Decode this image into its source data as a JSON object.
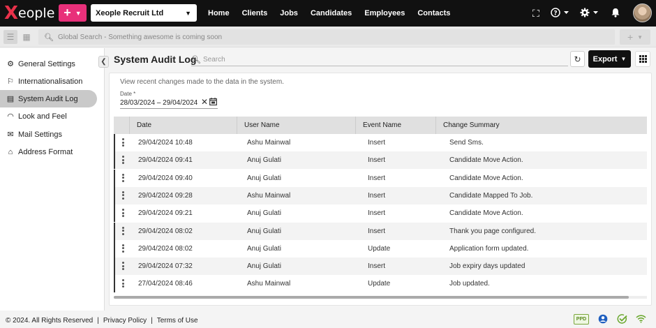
{
  "app": {
    "logo_x": "X",
    "logo_text": "eople",
    "add_label": "+",
    "company": "Xeople Recruit Ltd"
  },
  "nav": [
    "Home",
    "Clients",
    "Jobs",
    "Candidates",
    "Employees",
    "Contacts"
  ],
  "global_search": {
    "placeholder": "Global Search - Something awesome is coming soon"
  },
  "sidebar": {
    "items": [
      {
        "label": "General Settings",
        "icon": "gear-icon"
      },
      {
        "label": "Internationalisation",
        "icon": "flag-icon"
      },
      {
        "label": "System Audit Log",
        "icon": "audit-log-icon"
      },
      {
        "label": "Look and Feel",
        "icon": "palette-icon"
      },
      {
        "label": "Mail Settings",
        "icon": "mail-icon"
      },
      {
        "label": "Address Format",
        "icon": "home-icon"
      }
    ]
  },
  "page": {
    "title": "System Audit Log",
    "search_placeholder": "Search",
    "export_label": "Export",
    "description": "View recent changes made to the data in the system.",
    "date_label": "Date *",
    "date_value": "28/03/2024 – 29/04/2024"
  },
  "table": {
    "columns": [
      "Date",
      "User Name",
      "Event Name",
      "Change Summary"
    ],
    "rows": [
      {
        "date": "29/04/2024 10:48",
        "user": "Ashu Mainwal",
        "event": "Insert",
        "summary": "Send Sms."
      },
      {
        "date": "29/04/2024 09:41",
        "user": "Anuj Gulati",
        "event": "Insert",
        "summary": "Candidate Move Action."
      },
      {
        "date": "29/04/2024 09:40",
        "user": "Anuj Gulati",
        "event": "Insert",
        "summary": "Candidate Move Action."
      },
      {
        "date": "29/04/2024 09:28",
        "user": "Ashu Mainwal",
        "event": "Insert",
        "summary": "Candidate Mapped To Job."
      },
      {
        "date": "29/04/2024 09:21",
        "user": "Anuj Gulati",
        "event": "Insert",
        "summary": "Candidate Move Action."
      },
      {
        "date": "29/04/2024 08:02",
        "user": "Anuj Gulati",
        "event": "Insert",
        "summary": "Thank you page configured."
      },
      {
        "date": "29/04/2024 08:02",
        "user": "Anuj Gulati",
        "event": "Update",
        "summary": "Application form updated."
      },
      {
        "date": "29/04/2024 07:32",
        "user": "Anuj Gulati",
        "event": "Insert",
        "summary": "Job expiry days updated"
      },
      {
        "date": "27/04/2024 08:46",
        "user": "Ashu Mainwal",
        "event": "Update",
        "summary": "Job updated."
      }
    ]
  },
  "footer": {
    "copyright": "© 2024. All Rights Reserved",
    "privacy": "Privacy Policy",
    "terms": "Terms of Use",
    "separator": "|",
    "ppd": "PPD"
  },
  "colors": {
    "brand": "#e8314a",
    "accent": "#e8307a",
    "topbar": "#111111"
  }
}
